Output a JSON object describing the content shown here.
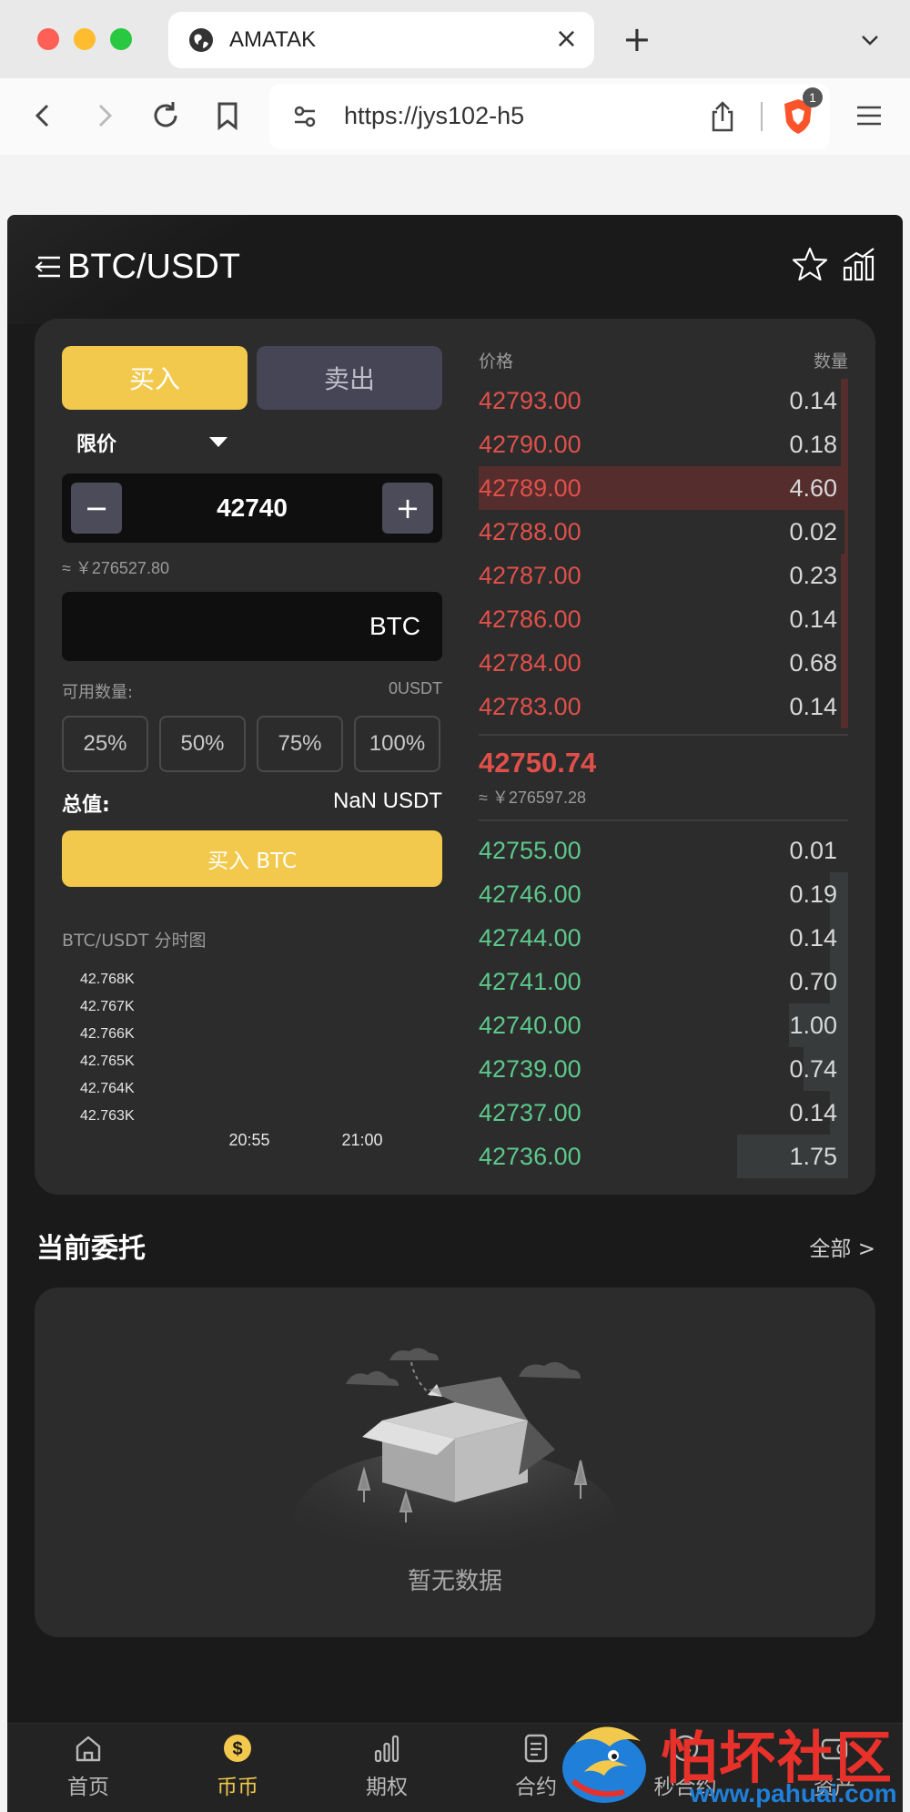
{
  "browser": {
    "tab_title": "AMATAK",
    "url": "https://jys102-h5",
    "shield_badge": "1"
  },
  "header": {
    "pair": "BTC/USDT"
  },
  "trade": {
    "buy_tab": "买入",
    "sell_tab": "卖出",
    "order_type": "限价",
    "price": "42740",
    "price_cny": "≈ ￥276527.80",
    "amount_unit": "BTC",
    "available_label": "可用数量:",
    "available_value": "0USDT",
    "percents": [
      "25%",
      "50%",
      "75%",
      "100%"
    ],
    "total_label": "总值:",
    "total_value": "NaN USDT",
    "submit": "买入 BTC",
    "mini_chart_title": "BTC/USDT 分时图"
  },
  "chart_data": {
    "type": "line",
    "title": "BTC/USDT 分时图",
    "y_ticks": [
      "42.768K",
      "42.767K",
      "42.766K",
      "42.765K",
      "42.764K",
      "42.763K"
    ],
    "x_ticks": [
      "20:55",
      "21:00"
    ],
    "series": []
  },
  "orderbook": {
    "price_header": "价格",
    "qty_header": "数量",
    "asks": [
      {
        "price": "42793.00",
        "qty": "0.14",
        "depth": 0.02
      },
      {
        "price": "42790.00",
        "qty": "0.18",
        "depth": 0.02
      },
      {
        "price": "42789.00",
        "qty": "4.60",
        "depth": 1.0
      },
      {
        "price": "42788.00",
        "qty": "0.02",
        "depth": 0.01
      },
      {
        "price": "42787.00",
        "qty": "0.23",
        "depth": 0.02
      },
      {
        "price": "42786.00",
        "qty": "0.14",
        "depth": 0.02
      },
      {
        "price": "42784.00",
        "qty": "0.68",
        "depth": 0.02
      },
      {
        "price": "42783.00",
        "qty": "0.14",
        "depth": 0.02
      }
    ],
    "last_price": "42750.74",
    "last_price_cny": "≈ ￥276597.28",
    "bids": [
      {
        "price": "42755.00",
        "qty": "0.01",
        "depth": 0.0
      },
      {
        "price": "42746.00",
        "qty": "0.19",
        "depth": 0.05
      },
      {
        "price": "42744.00",
        "qty": "0.14",
        "depth": 0.05
      },
      {
        "price": "42741.00",
        "qty": "0.70",
        "depth": 0.05
      },
      {
        "price": "42740.00",
        "qty": "1.00",
        "depth": 0.16
      },
      {
        "price": "42739.00",
        "qty": "0.74",
        "depth": 0.12
      },
      {
        "price": "42737.00",
        "qty": "0.14",
        "depth": 0.05
      },
      {
        "price": "42736.00",
        "qty": "1.75",
        "depth": 0.3
      }
    ],
    "ask_color": "#e0504a",
    "bid_color": "#5cc98b"
  },
  "orders": {
    "title": "当前委托",
    "all": "全部 >",
    "empty": "暂无数据"
  },
  "nav": {
    "items": [
      {
        "label": "首页",
        "icon": "home-icon"
      },
      {
        "label": "币币",
        "icon": "coin-icon"
      },
      {
        "label": "期权",
        "icon": "bar-chart-icon"
      },
      {
        "label": "合约",
        "icon": "document-icon"
      },
      {
        "label": "秒合约",
        "icon": "clock-icon"
      },
      {
        "label": "资产",
        "icon": "wallet-icon"
      }
    ],
    "active_color": "#f2c94c"
  },
  "watermark": {
    "text": "怕坏社区",
    "url": "www.pahuai.com"
  }
}
